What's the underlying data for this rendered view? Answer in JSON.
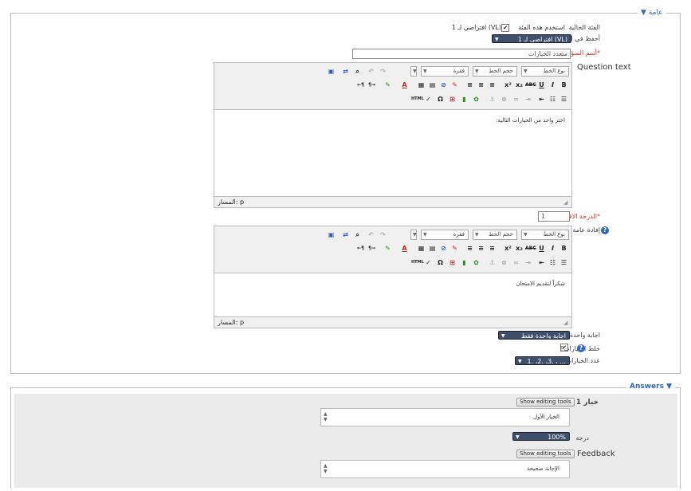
{
  "general": {
    "legend": "▼ عامة",
    "current_category_label": "الفئة الحالية",
    "current_category_value": "افتراضي لـ 1 (VL)",
    "use_category_checkbox": "✔",
    "use_category_label": "استخدم هذه الفئة",
    "save_in_category_label": "أحفظ في الفئة",
    "save_in_category_value": "افتراضي لـ 1 (VL)",
    "question_name_label": "أسم السؤال",
    "question_name_value": "متعدد الخيارات",
    "question_text_label": "Question text",
    "default_mark_label": "الدرجة الافتراضية",
    "default_mark_value": "1",
    "general_feedback_label": "إفادة عامة",
    "one_or_multiple_label": "اجابة واحدة أو عدة اجابات؟",
    "one_or_multiple_value": "اجابة واحدة فقط",
    "shuffle_label": "خلط الخيارات؟",
    "shuffle_checkbox": "✔",
    "numbering_label": "عدد الخيارات",
    "numbering_value": "1. ،2. ،3. ، ..."
  },
  "editor": {
    "font_family": "نوع الخط",
    "font_size": "حجم الخط",
    "paragraph": "فقرة",
    "path_label": "المسار:",
    "path_value": "p"
  },
  "question_editor": {
    "content": "اختر واحد من الخيارات التالية:"
  },
  "feedback_editor": {
    "content": "شكراً لتقديم الامتحان"
  },
  "answers": {
    "legend": "Answers ▼",
    "choice1_label": "خيار 1",
    "show_editing_tools_1": "Show editing tools",
    "choice1_text": "الخيار الأول",
    "grade_label": "درجة",
    "grade_value": "100%",
    "feedback_label": "Feedback",
    "show_editing_tools_2": "Show editing tools",
    "feedback_text": "الإجابة صحيحة"
  }
}
